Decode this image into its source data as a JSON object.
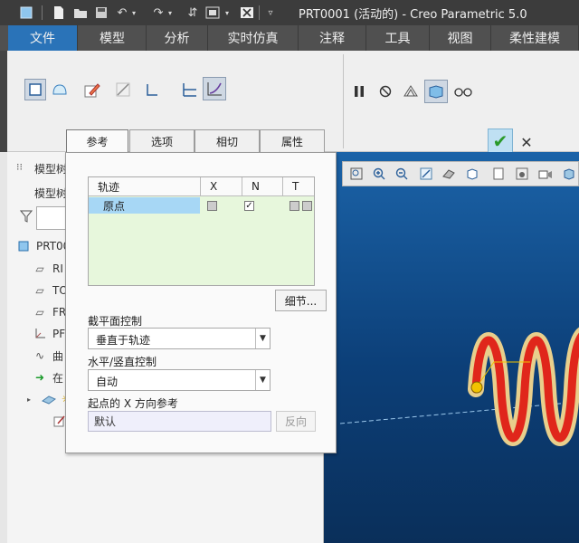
{
  "window": {
    "title": "PRT0001 (活动的) - Creo Parametric 5.0"
  },
  "menu": {
    "tabs": [
      "文件",
      "模型",
      "分析",
      "实时仿真",
      "注释",
      "工具",
      "视图",
      "柔性建模"
    ],
    "active": "文件"
  },
  "sub_tabs": [
    "参考",
    "选项",
    "相切",
    "属性"
  ],
  "left_panel": {
    "header": "模型树",
    "sub_header": "模型树",
    "tree": [
      {
        "icon": "part-icon",
        "label": "PRT00"
      },
      {
        "icon": "datum-plane-icon",
        "label": "RI"
      },
      {
        "icon": "datum-plane-icon",
        "label": "TO"
      },
      {
        "icon": "datum-plane-icon",
        "label": "FR"
      },
      {
        "icon": "csys-icon",
        "label": "PF"
      },
      {
        "icon": "curve-icon",
        "label": "曲"
      },
      {
        "icon": "insert-arrow-icon",
        "label": "在"
      }
    ]
  },
  "references_panel": {
    "table": {
      "headers": [
        "轨迹",
        "X",
        "N",
        "T"
      ],
      "rows": [
        {
          "name": "原点",
          "x": false,
          "n": true,
          "t": false
        }
      ]
    },
    "detail_button": "细节...",
    "section_plane_control": {
      "label": "截平面控制",
      "value": "垂直于轨迹"
    },
    "hv_control": {
      "label": "水平/竖直控制",
      "value": "自动"
    },
    "start_x_ref": {
      "label": "起点的 X 方向参考",
      "value": "默认",
      "reverse_button": "反向"
    }
  },
  "viewport": {
    "background_top": "#1b63a8",
    "background_bottom": "#0a2f5a",
    "sweep_color": "#e0261b",
    "sweep_outline": "#e8d08a",
    "point_color": "#f2c200"
  },
  "colors": {
    "accent": "#2a73b8",
    "table_bg": "#e7f7dc",
    "row_selected": "#a7d7f5"
  }
}
